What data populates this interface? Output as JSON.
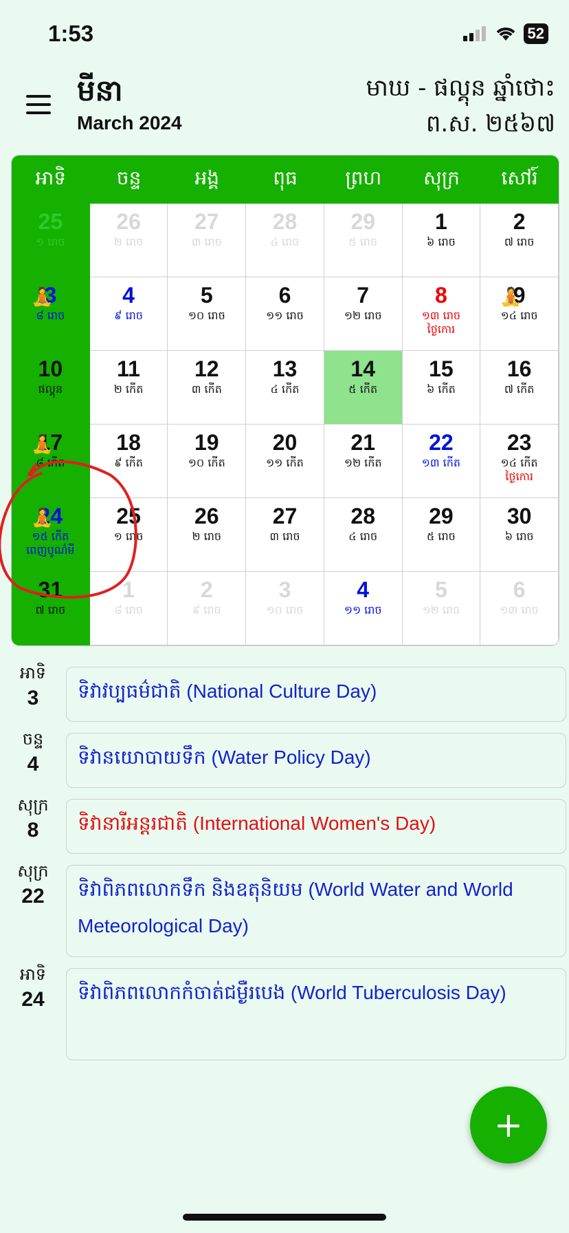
{
  "status_bar": {
    "time": "1:53",
    "battery": "52"
  },
  "header": {
    "month_khmer": "មីនា",
    "month_english": "March 2024",
    "lunar_line1": "មាឃ - ផល្គុន ឆ្នាំថោះ",
    "lunar_line2": "ព.ស. ២៥៦៧"
  },
  "calendar": {
    "weekdays": [
      "អាទិ",
      "ចន្ទ",
      "អង្គ",
      "ពុធ",
      "ព្រហ",
      "សុក្រ",
      "សៅរ៍"
    ],
    "weeks": [
      [
        {
          "n": "25",
          "l": "១ រោច"
        },
        {
          "n": "26",
          "l": "២ រោច"
        },
        {
          "n": "27",
          "l": "៣ រោច"
        },
        {
          "n": "28",
          "l": "៤ រោច"
        },
        {
          "n": "29",
          "l": "៥ រោច"
        },
        {
          "n": "1",
          "l": "៦ រោច"
        },
        {
          "n": "2",
          "l": "៧ រោច"
        }
      ],
      [
        {
          "n": "3",
          "l": "៨ រោច"
        },
        {
          "n": "4",
          "l": "៩ រោច"
        },
        {
          "n": "5",
          "l": "១០ រោច"
        },
        {
          "n": "6",
          "l": "១១ រោច"
        },
        {
          "n": "7",
          "l": "១២ រោច"
        },
        {
          "n": "8",
          "l": "១៣ រោច",
          "h": "ថ្ងៃកោរ"
        },
        {
          "n": "9",
          "l": "១៤ រោច"
        }
      ],
      [
        {
          "n": "10",
          "l": "ផល្គុន"
        },
        {
          "n": "11",
          "l": "២ កើត"
        },
        {
          "n": "12",
          "l": "៣ កើត"
        },
        {
          "n": "13",
          "l": "៤ កើត"
        },
        {
          "n": "14",
          "l": "៥ កើត"
        },
        {
          "n": "15",
          "l": "៦ កើត"
        },
        {
          "n": "16",
          "l": "៧ កើត"
        }
      ],
      [
        {
          "n": "17",
          "l": "៨ កើត"
        },
        {
          "n": "18",
          "l": "៩ កើត"
        },
        {
          "n": "19",
          "l": "១០ កើត"
        },
        {
          "n": "20",
          "l": "១១ កើត"
        },
        {
          "n": "21",
          "l": "១២ កើត"
        },
        {
          "n": "22",
          "l": "១៣ កើត"
        },
        {
          "n": "23",
          "l": "១៤ កើត",
          "h": "ថ្ងៃកោរ"
        }
      ],
      [
        {
          "n": "24",
          "l": "១៥ កើត",
          "h": "ពេញបូណ៌មី"
        },
        {
          "n": "25",
          "l": "១ រោច"
        },
        {
          "n": "26",
          "l": "២ រោច"
        },
        {
          "n": "27",
          "l": "៣ រោច"
        },
        {
          "n": "28",
          "l": "៤ រោច"
        },
        {
          "n": "29",
          "l": "៥ រោច"
        },
        {
          "n": "30",
          "l": "៦ រោច"
        }
      ],
      [
        {
          "n": "31",
          "l": "៧ រោច"
        },
        {
          "n": "1",
          "l": "៨ រោច"
        },
        {
          "n": "2",
          "l": "៩ រោច"
        },
        {
          "n": "3",
          "l": "១០ រោច"
        },
        {
          "n": "4",
          "l": "១១ រោច"
        },
        {
          "n": "5",
          "l": "១២ រោច"
        },
        {
          "n": "6",
          "l": "១៣ រោច"
        }
      ]
    ]
  },
  "events": [
    {
      "dow": "អាទិ",
      "date": "3",
      "text": "ទិវាវប្បធម៌ជាតិ (National Culture Day)"
    },
    {
      "dow": "ចន្ទ",
      "date": "4",
      "text": "ទិវានយោបាយទឹក (Water Policy Day)"
    },
    {
      "dow": "សុក្រ",
      "date": "8",
      "text": "ទិវានារីអន្តរជាតិ (International Women's Day)"
    },
    {
      "dow": "សុក្រ",
      "date": "22",
      "text": "ទិវាពិភពលោកទឹក និងឧតុនិយម (World Water and World Meteorological Day)"
    },
    {
      "dow": "អាទិ",
      "date": "24",
      "text": "ទិវាពិភពលោកកំចាត់ជម្ងឺរបេង (World Tuberculosis Day)"
    }
  ],
  "fab": {
    "label": "+"
  },
  "colors": {
    "accent": "#15b000",
    "today": "#8ee38c",
    "holiday_blue": "#0011dd",
    "holiday_red": "#e00000"
  }
}
